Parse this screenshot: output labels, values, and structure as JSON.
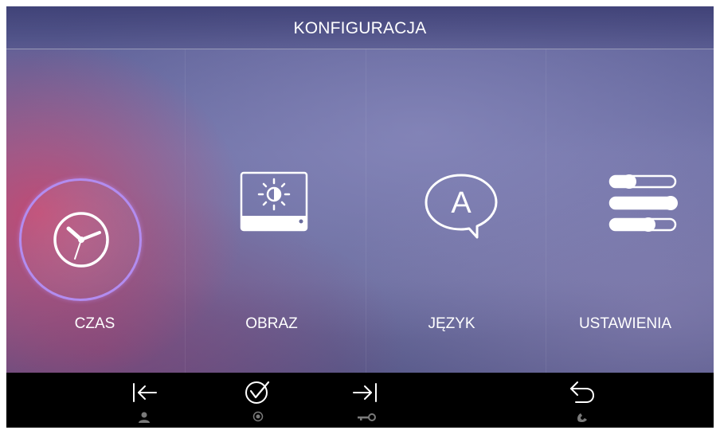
{
  "header": {
    "title": "KONFIGURACJA"
  },
  "menu": {
    "items": [
      {
        "label": "CZAS",
        "icon": "clock-icon",
        "selected": true
      },
      {
        "label": "OBRAZ",
        "icon": "brightness-icon",
        "selected": false
      },
      {
        "label": "JĘZYK",
        "icon": "language-icon",
        "selected": false
      },
      {
        "label": "USTAWIENIA",
        "icon": "settings-sliders-icon",
        "selected": false
      }
    ]
  },
  "bottom_bar": {
    "buttons": [
      {
        "icon": "arrow-left-bar-icon",
        "sub_icon": "user-icon"
      },
      {
        "icon": "check-circle-icon",
        "sub_icon": "record-dot-icon"
      },
      {
        "icon": "arrow-right-bar-icon",
        "sub_icon": "key-icon"
      },
      {
        "icon": "back-arrow-icon",
        "sub_icon": "phone-icon"
      }
    ]
  },
  "colors": {
    "accent": "#b28cf0",
    "text": "#ffffff",
    "bar": "#000000"
  }
}
